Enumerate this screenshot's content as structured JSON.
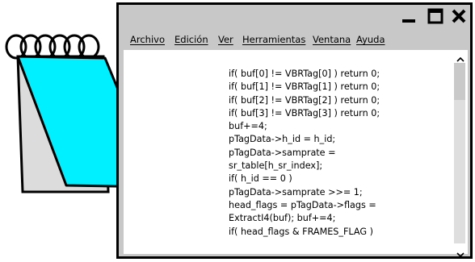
{
  "icons": {
    "notepad": "notepad-icon",
    "minimize": "minimize-icon",
    "maximize": "maximize-icon",
    "close": "close-icon",
    "scroll_up": "chevron-up-icon",
    "scroll_down": "chevron-down-icon"
  },
  "colors": {
    "notepad_page": "#00f0ff",
    "window_frame": "#000000",
    "chrome": "#c8c8c8"
  },
  "menu": {
    "items": [
      "Archivo",
      "Edición",
      "Ver",
      "Herramientas",
      "Ventana",
      "Ayuda"
    ]
  },
  "editor": {
    "lines": [
      "if( buf[0] != VBRTag[0] ) return 0;",
      "if( buf[1] != VBRTag[1] ) return 0;",
      "if( buf[2] != VBRTag[2] ) return 0;",
      "if( buf[3] != VBRTag[3] ) return 0;",
      "buf+=4;",
      "pTagData->h_id = h_id;",
      "pTagData->samprate =",
      "sr_table[h_sr_index];",
      "if( h_id == 0 )",
      "pTagData->samprate >>= 1;",
      "head_flags = pTagData->flags =",
      "ExtractI4(buf); buf+=4;",
      "if( head_flags & FRAMES_FLAG )"
    ]
  }
}
